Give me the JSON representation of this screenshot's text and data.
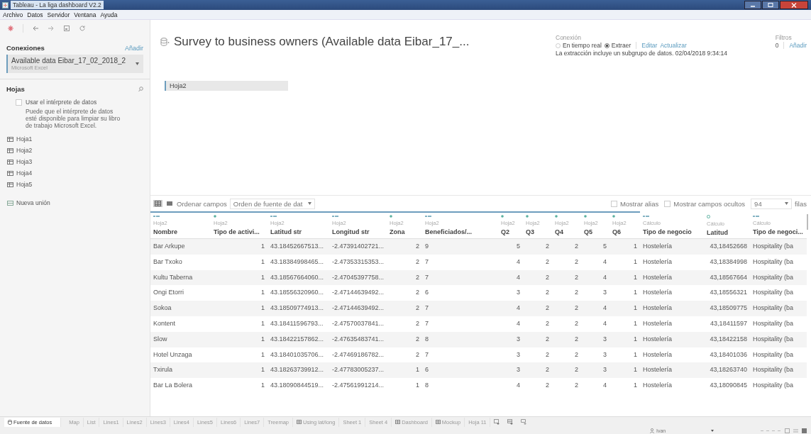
{
  "window": {
    "title": "Tableau - La liga dashboard V2.2"
  },
  "menu": [
    "Archivo",
    "Datos",
    "Servidor",
    "Ventana",
    "Ayuda"
  ],
  "sidebar": {
    "connections_label": "Conexiones",
    "add_link": "Añadir",
    "connection": {
      "name": "Available data Eibar_17_02_2018_2",
      "type": "Microsoft Excel"
    },
    "sheets_label": "Hojas",
    "interpreter": {
      "label": "Usar el intérprete de datos",
      "checked": false,
      "hint": "Puede que el intérprete de datos esté disponible para limpiar su libro de trabajo Microsoft Excel."
    },
    "sheets": [
      "Hoja1",
      "Hoja2",
      "Hoja3",
      "Hoja4",
      "Hoja5"
    ],
    "new_union": "Nueva unión"
  },
  "header": {
    "title": "Survey to business owners (Available data Eibar_17_...",
    "connection_label": "Conexión",
    "modes": [
      {
        "label": "En tiempo real",
        "selected": false
      },
      {
        "label": "Extraer",
        "selected": true
      }
    ],
    "links": [
      "Editar",
      "Actualizar"
    ],
    "extract_note": "La extracción incluye un subgrupo de datos. 02/04/2018 9:34:14",
    "filters_label": "Filtros",
    "filters_count": "0",
    "filters_add": "Añadir"
  },
  "canvas": {
    "table_pill": "Hoja2"
  },
  "grid_toolbar": {
    "views": [
      {
        "kind": "grid",
        "selected": true
      },
      {
        "kind": "list",
        "selected": false
      }
    ],
    "sort_label": "Ordenar campos",
    "sort_value": "Orden de fuente de dat",
    "options": [
      {
        "label": "Mostrar alias",
        "checked": false
      },
      {
        "label": "Mostrar campos ocultos",
        "checked": false
      }
    ],
    "rows_value": "94",
    "rows_label": "filas"
  },
  "table": {
    "columns": [
      {
        "name": "Nombre",
        "source": "Hoja2",
        "kind": "string"
      },
      {
        "name": "Tipo de activi...",
        "source": "Hoja2",
        "kind": "number"
      },
      {
        "name": "Latitud str",
        "source": "Hoja2",
        "kind": "string"
      },
      {
        "name": "Longitud str",
        "source": "Hoja2",
        "kind": "string"
      },
      {
        "name": "Zona",
        "source": "Hoja2",
        "kind": "number"
      },
      {
        "name": "Beneficiados/...",
        "source": "Hoja2",
        "kind": "string"
      },
      {
        "name": "Q2",
        "source": "Hoja2",
        "kind": "number"
      },
      {
        "name": "Q3",
        "source": "Hoja2",
        "kind": "number"
      },
      {
        "name": "Q4",
        "source": "Hoja2",
        "kind": "number"
      },
      {
        "name": "Q5",
        "source": "Hoja2",
        "kind": "number"
      },
      {
        "name": "Q6",
        "source": "Hoja2",
        "kind": "number"
      },
      {
        "name": "Tipo de negocio",
        "source": "Cálculo",
        "kind": "string"
      },
      {
        "name": "Latitud",
        "source": "Cálculo",
        "kind": "geo"
      },
      {
        "name": "Tipo de negoci...",
        "source": "Cálculo",
        "kind": "string"
      }
    ],
    "rows": [
      [
        "Bar Arkupe",
        "1",
        "43.18452667513...",
        "-2.47391402721...",
        "2",
        "9",
        "5",
        "2",
        "2",
        "5",
        "1",
        "Hostelería",
        "43,18452668",
        "Hospitality (ba"
      ],
      [
        "Bar Txoko",
        "1",
        "43.18384998465...",
        "-2.47353315353...",
        "2",
        "7",
        "4",
        "2",
        "2",
        "4",
        "1",
        "Hostelería",
        "43,18384998",
        "Hospitality (ba"
      ],
      [
        "Kultu Taberna",
        "1",
        "43.18567664060...",
        "-2.47045397758...",
        "2",
        "7",
        "4",
        "2",
        "2",
        "4",
        "1",
        "Hostelería",
        "43,18567664",
        "Hospitality (ba"
      ],
      [
        "Ongi Etorri",
        "1",
        "43.18556320960...",
        "-2.47144639492...",
        "2",
        "6",
        "3",
        "2",
        "2",
        "3",
        "1",
        "Hostelería",
        "43,18556321",
        "Hospitality (ba"
      ],
      [
        "Sokoa",
        "1",
        "43.18509774913...",
        "-2.47144639492...",
        "2",
        "7",
        "4",
        "2",
        "2",
        "4",
        "1",
        "Hostelería",
        "43,18509775",
        "Hospitality (ba"
      ],
      [
        "Kontent",
        "1",
        "43.18411596793...",
        "-2.47570037841...",
        "2",
        "7",
        "4",
        "2",
        "2",
        "4",
        "1",
        "Hostelería",
        "43,18411597",
        "Hospitality (ba"
      ],
      [
        "Slow",
        "1",
        "43.18422157862...",
        "-2.47635483741...",
        "2",
        "8",
        "3",
        "2",
        "2",
        "3",
        "1",
        "Hostelería",
        "43,18422158",
        "Hospitality (ba"
      ],
      [
        "Hotel Unzaga",
        "1",
        "43.18401035706...",
        "-2.47469186782...",
        "2",
        "7",
        "3",
        "2",
        "2",
        "3",
        "1",
        "Hostelería",
        "43,18401036",
        "Hospitality (ba"
      ],
      [
        "Txirula",
        "1",
        "43.18263739912...",
        "-2.47783005237...",
        "1",
        "6",
        "3",
        "2",
        "2",
        "3",
        "1",
        "Hostelería",
        "43,18263740",
        "Hospitality (ba"
      ],
      [
        "Bar La Bolera",
        "1",
        "43.18090844519...",
        "-2.47561991214...",
        "1",
        "8",
        "4",
        "2",
        "2",
        "4",
        "1",
        "Hostelería",
        "43,18090845",
        "Hospitality (ba"
      ]
    ]
  },
  "sheet_tabs": [
    {
      "label": "Fuente de datos",
      "kind": "source",
      "selected": true
    },
    {
      "label": "Map",
      "kind": "sheet",
      "selected": false
    },
    {
      "label": "List",
      "kind": "sheet",
      "selected": false
    },
    {
      "label": "Lines1",
      "kind": "sheet",
      "selected": false
    },
    {
      "label": "Lines2",
      "kind": "sheet",
      "selected": false
    },
    {
      "label": "Lines3",
      "kind": "sheet",
      "selected": false
    },
    {
      "label": "Lines4",
      "kind": "sheet",
      "selected": false
    },
    {
      "label": "Lines5",
      "kind": "sheet",
      "selected": false
    },
    {
      "label": "Lines6",
      "kind": "sheet",
      "selected": false
    },
    {
      "label": "Lines7",
      "kind": "sheet",
      "selected": false
    },
    {
      "label": "Treemap",
      "kind": "sheet",
      "selected": false
    },
    {
      "label": "Using lat/long",
      "kind": "dashboard",
      "selected": false
    },
    {
      "label": "Sheet 1",
      "kind": "sheet",
      "selected": false
    },
    {
      "label": "Sheet 4",
      "kind": "sheet",
      "selected": false
    },
    {
      "label": "Dashboard",
      "kind": "dashboard",
      "selected": false
    },
    {
      "label": "Mockup",
      "kind": "dashboard",
      "selected": false
    },
    {
      "label": "Hoja 11",
      "kind": "sheet",
      "selected": false
    }
  ],
  "status_bar": {
    "user": "Ivan"
  }
}
